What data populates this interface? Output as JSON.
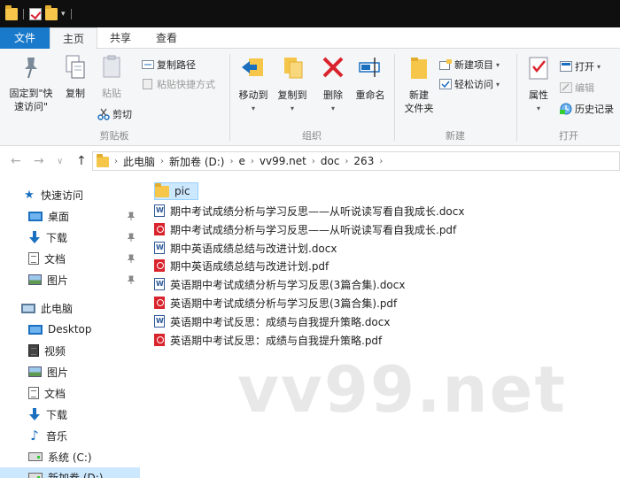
{
  "tabs": [
    {
      "label": "文件"
    },
    {
      "label": "主页"
    },
    {
      "label": "共享"
    },
    {
      "label": "查看"
    }
  ],
  "ribbon": {
    "clipboard": {
      "pin_label_1": "固定到\"快",
      "pin_label_2": "速访问\"",
      "copy": "复制",
      "paste": "粘贴",
      "copy_path": "复制路径",
      "paste_shortcut": "粘贴快捷方式",
      "cut": "剪切",
      "group_label": "剪贴板"
    },
    "organize": {
      "move_to": "移动到",
      "copy_to": "复制到",
      "delete": "删除",
      "rename": "重命名",
      "group_label": "组织"
    },
    "new": {
      "new_folder_1": "新建",
      "new_folder_2": "文件夹",
      "new_item": "新建项目",
      "easy_access": "轻松访问",
      "group_label": "新建"
    },
    "open": {
      "properties": "属性",
      "open": "打开",
      "edit": "编辑",
      "history": "历史记录",
      "group_label": "打开"
    }
  },
  "breadcrumb": [
    "此电脑",
    "新加卷 (D:)",
    "e",
    "vv99.net",
    "doc",
    "263"
  ],
  "nav": {
    "quick_access": "快速访问",
    "quick_items": [
      {
        "label": "桌面"
      },
      {
        "label": "下载"
      },
      {
        "label": "文档"
      },
      {
        "label": "图片"
      }
    ],
    "this_pc": "此电脑",
    "pc_items": [
      {
        "label": "Desktop"
      },
      {
        "label": "视频"
      },
      {
        "label": "图片"
      },
      {
        "label": "文档"
      },
      {
        "label": "下载"
      },
      {
        "label": "音乐"
      },
      {
        "label": "系统 (C:)"
      },
      {
        "label": "新加卷 (D:)"
      }
    ]
  },
  "files": [
    {
      "name": "pic",
      "type": "folder"
    },
    {
      "name": "期中考试成绩分析与学习反思——从听说读写看自我成长.docx",
      "type": "docx"
    },
    {
      "name": "期中考试成绩分析与学习反思——从听说读写看自我成长.pdf",
      "type": "pdf"
    },
    {
      "name": "期中英语成绩总结与改进计划.docx",
      "type": "docx"
    },
    {
      "name": "期中英语成绩总结与改进计划.pdf",
      "type": "pdf"
    },
    {
      "name": "英语期中考试成绩分析与学习反思(3篇合集).docx",
      "type": "docx"
    },
    {
      "name": "英语期中考试成绩分析与学习反思(3篇合集).pdf",
      "type": "pdf"
    },
    {
      "name": "英语期中考试反思：成绩与自我提升策略.docx",
      "type": "docx"
    },
    {
      "name": "英语期中考试反思：成绩与自我提升策略.pdf",
      "type": "pdf"
    }
  ],
  "watermark": "vv99.net",
  "colors": {
    "accent": "#1979ca",
    "selection": "#cce8ff",
    "ribbon_bg": "#f5f6f7"
  }
}
